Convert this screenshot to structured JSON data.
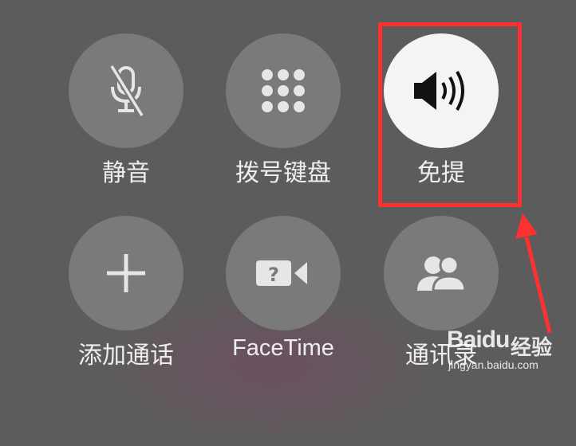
{
  "call_controls": {
    "row1": {
      "mute": {
        "label": "静音",
        "icon": "microphone-muted-icon"
      },
      "keypad": {
        "label": "拨号键盘",
        "icon": "keypad-icon"
      },
      "speaker": {
        "label": "免提",
        "icon": "speaker-icon",
        "active": true
      }
    },
    "row2": {
      "add_call": {
        "label": "添加通话",
        "icon": "plus-icon"
      },
      "facetime": {
        "label": "FaceTime",
        "icon": "facetime-video-icon"
      },
      "contacts": {
        "label": "通讯录",
        "icon": "contacts-icon"
      }
    }
  },
  "annotation": {
    "highlight_target": "speaker",
    "color": "#ff3030"
  },
  "watermark": {
    "logo": "Baidu",
    "jingyan": "经验",
    "url": "jingyan.baidu.com"
  },
  "colors": {
    "background": "#5d5c5d",
    "button": "#7b7a7b",
    "button_active": "#f4f4f4",
    "text": "#eeeeee"
  }
}
